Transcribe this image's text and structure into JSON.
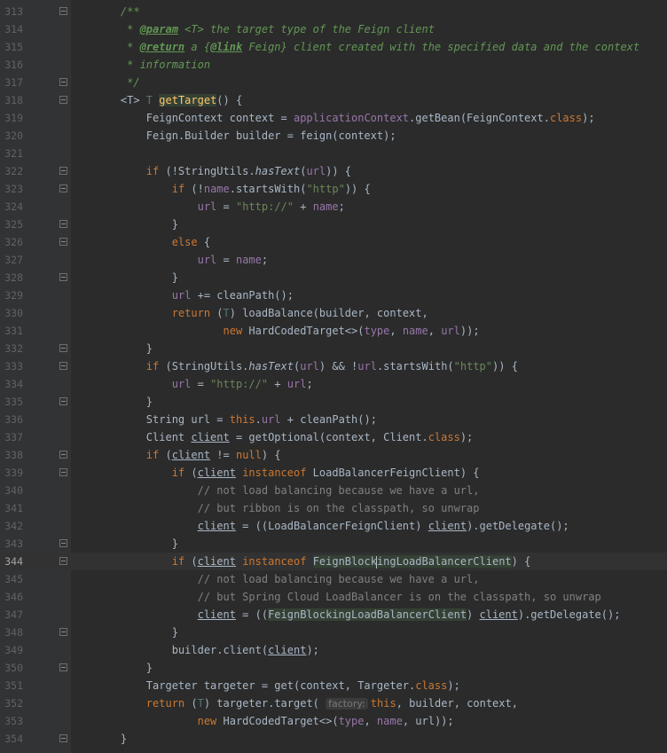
{
  "editor": {
    "current_line": "344",
    "lines": [
      {
        "n": "313",
        "fold": "open",
        "tokens": [
          [
            "    ",
            ""
          ],
          [
            "/**",
            "t-doc"
          ]
        ]
      },
      {
        "n": "314",
        "fold": "",
        "tokens": [
          [
            "     * ",
            "t-doc"
          ],
          [
            "@param",
            "t-tag"
          ],
          [
            " ",
            "t-doc"
          ],
          [
            "<T>",
            "t-doc"
          ],
          [
            " the target type of the Feign client",
            "t-doc"
          ]
        ]
      },
      {
        "n": "315",
        "fold": "",
        "tokens": [
          [
            "     * ",
            "t-doc"
          ],
          [
            "@return",
            "t-tag"
          ],
          [
            " a {",
            "t-doc"
          ],
          [
            "@link",
            "t-tag"
          ],
          [
            " Feign} client created with the specified data and the context",
            "t-doc"
          ]
        ]
      },
      {
        "n": "316",
        "fold": "",
        "tokens": [
          [
            "     * information",
            "t-doc"
          ]
        ]
      },
      {
        "n": "317",
        "fold": "close",
        "tokens": [
          [
            "     */",
            "t-doc"
          ]
        ]
      },
      {
        "n": "318",
        "fold": "open",
        "tokens": [
          [
            "    <T> ",
            ""
          ],
          [
            "T",
            "t-typ"
          ],
          [
            " ",
            ""
          ],
          [
            "getTarget",
            "t-fn t-hl"
          ],
          [
            "() {",
            ""
          ]
        ]
      },
      {
        "n": "319",
        "fold": "",
        "tokens": [
          [
            "        FeignContext context = ",
            ""
          ],
          [
            "applicationContext",
            "t-fld"
          ],
          [
            ".getBean(FeignContext.",
            ""
          ],
          [
            "class",
            "t-kw"
          ],
          [
            ");",
            ""
          ]
        ]
      },
      {
        "n": "320",
        "fold": "",
        "tokens": [
          [
            "        Feign.Builder builder = feign(context);",
            ""
          ]
        ]
      },
      {
        "n": "321",
        "fold": "",
        "tokens": []
      },
      {
        "n": "322",
        "fold": "open",
        "tokens": [
          [
            "        ",
            ""
          ],
          [
            "if",
            "t-kw"
          ],
          [
            " (!StringUtils.",
            ""
          ],
          [
            "hasText",
            "t-it"
          ],
          [
            "(",
            ""
          ],
          [
            "url",
            "t-fld"
          ],
          [
            ")) {",
            ""
          ]
        ]
      },
      {
        "n": "323",
        "fold": "open",
        "tokens": [
          [
            "            ",
            ""
          ],
          [
            "if",
            "t-kw"
          ],
          [
            " (!",
            ""
          ],
          [
            "name",
            "t-fld"
          ],
          [
            ".startsWith(",
            ""
          ],
          [
            "\"http\"",
            "t-str"
          ],
          [
            ")) {",
            ""
          ]
        ]
      },
      {
        "n": "324",
        "fold": "",
        "tokens": [
          [
            "                ",
            ""
          ],
          [
            "url",
            "t-fld"
          ],
          [
            " = ",
            ""
          ],
          [
            "\"http://\"",
            "t-str"
          ],
          [
            " + ",
            ""
          ],
          [
            "name",
            "t-fld"
          ],
          [
            ";",
            ""
          ]
        ]
      },
      {
        "n": "325",
        "fold": "close",
        "tokens": [
          [
            "            }",
            ""
          ]
        ]
      },
      {
        "n": "326",
        "fold": "open",
        "tokens": [
          [
            "            ",
            ""
          ],
          [
            "else",
            "t-kw"
          ],
          [
            " {",
            ""
          ]
        ]
      },
      {
        "n": "327",
        "fold": "",
        "tokens": [
          [
            "                ",
            ""
          ],
          [
            "url",
            "t-fld"
          ],
          [
            " = ",
            ""
          ],
          [
            "name",
            "t-fld"
          ],
          [
            ";",
            ""
          ]
        ]
      },
      {
        "n": "328",
        "fold": "close",
        "tokens": [
          [
            "            }",
            ""
          ]
        ]
      },
      {
        "n": "329",
        "fold": "",
        "tokens": [
          [
            "            ",
            ""
          ],
          [
            "url",
            "t-fld"
          ],
          [
            " += cleanPath();",
            ""
          ]
        ]
      },
      {
        "n": "330",
        "fold": "",
        "tokens": [
          [
            "            ",
            ""
          ],
          [
            "return",
            "t-kw"
          ],
          [
            " (",
            ""
          ],
          [
            "T",
            "t-typ"
          ],
          [
            ") loadBalance(builder, context,",
            ""
          ]
        ]
      },
      {
        "n": "331",
        "fold": "",
        "tokens": [
          [
            "                    ",
            ""
          ],
          [
            "new",
            "t-kw"
          ],
          [
            " HardCodedTarget<>(",
            ""
          ],
          [
            "type",
            "t-fld"
          ],
          [
            ", ",
            ""
          ],
          [
            "name",
            "t-fld"
          ],
          [
            ", ",
            ""
          ],
          [
            "url",
            "t-fld"
          ],
          [
            "));",
            ""
          ]
        ]
      },
      {
        "n": "332",
        "fold": "close",
        "tokens": [
          [
            "        }",
            ""
          ]
        ]
      },
      {
        "n": "333",
        "fold": "open",
        "tokens": [
          [
            "        ",
            ""
          ],
          [
            "if",
            "t-kw"
          ],
          [
            " (StringUtils.",
            ""
          ],
          [
            "hasText",
            "t-it"
          ],
          [
            "(",
            ""
          ],
          [
            "url",
            "t-fld"
          ],
          [
            ") && !",
            ""
          ],
          [
            "url",
            "t-fld"
          ],
          [
            ".startsWith(",
            ""
          ],
          [
            "\"http\"",
            "t-str"
          ],
          [
            ")) {",
            ""
          ]
        ]
      },
      {
        "n": "334",
        "fold": "",
        "tokens": [
          [
            "            ",
            ""
          ],
          [
            "url",
            "t-fld"
          ],
          [
            " = ",
            ""
          ],
          [
            "\"http://\"",
            "t-str"
          ],
          [
            " + ",
            ""
          ],
          [
            "url",
            "t-fld"
          ],
          [
            ";",
            ""
          ]
        ]
      },
      {
        "n": "335",
        "fold": "close",
        "tokens": [
          [
            "        }",
            ""
          ]
        ]
      },
      {
        "n": "336",
        "fold": "",
        "tokens": [
          [
            "        String url = ",
            ""
          ],
          [
            "this",
            "t-kw"
          ],
          [
            ".",
            ""
          ],
          [
            "url",
            "t-fld"
          ],
          [
            " + cleanPath();",
            ""
          ]
        ]
      },
      {
        "n": "337",
        "fold": "",
        "tokens": [
          [
            "        Client ",
            ""
          ],
          [
            "client",
            "t-ul"
          ],
          [
            " = getOptional(context, Client.",
            ""
          ],
          [
            "class",
            "t-kw"
          ],
          [
            ");",
            ""
          ]
        ]
      },
      {
        "n": "338",
        "fold": "open",
        "tokens": [
          [
            "        ",
            ""
          ],
          [
            "if",
            "t-kw"
          ],
          [
            " (",
            ""
          ],
          [
            "client",
            "t-ul"
          ],
          [
            " != ",
            ""
          ],
          [
            "null",
            "t-kw"
          ],
          [
            ") {",
            ""
          ]
        ]
      },
      {
        "n": "339",
        "fold": "open",
        "tokens": [
          [
            "            ",
            ""
          ],
          [
            "if",
            "t-kw"
          ],
          [
            " (",
            ""
          ],
          [
            "client",
            "t-ul"
          ],
          [
            " ",
            ""
          ],
          [
            "instanceof",
            "t-kw"
          ],
          [
            " LoadBalancerFeignClient) {",
            ""
          ]
        ]
      },
      {
        "n": "340",
        "fold": "",
        "tokens": [
          [
            "                // not load balancing because we have a url,",
            "t-com"
          ]
        ]
      },
      {
        "n": "341",
        "fold": "",
        "tokens": [
          [
            "                // but ribbon is on the classpath, so unwrap",
            "t-com"
          ]
        ]
      },
      {
        "n": "342",
        "fold": "",
        "tokens": [
          [
            "                ",
            ""
          ],
          [
            "client",
            "t-ul"
          ],
          [
            " = ((LoadBalancerFeignClient) ",
            ""
          ],
          [
            "client",
            "t-ul"
          ],
          [
            ").getDelegate();",
            ""
          ]
        ]
      },
      {
        "n": "343",
        "fold": "close",
        "tokens": [
          [
            "            }",
            ""
          ]
        ]
      },
      {
        "n": "344",
        "fold": "open",
        "tokens": [
          [
            "            ",
            ""
          ],
          [
            "if",
            "t-kw"
          ],
          [
            " (",
            ""
          ],
          [
            "client",
            "t-ul"
          ],
          [
            " ",
            ""
          ],
          [
            "instanceof",
            "t-kw"
          ],
          [
            " ",
            ""
          ],
          [
            "FeignBlockingLoadBalancerClient",
            "t-ident"
          ],
          [
            ") {",
            ""
          ]
        ],
        "caret_after": "FeignBlock"
      },
      {
        "n": "345",
        "fold": "",
        "tokens": [
          [
            "                // not load balancing because we have a url,",
            "t-com"
          ]
        ]
      },
      {
        "n": "346",
        "fold": "",
        "tokens": [
          [
            "                // but Spring Cloud LoadBalancer is on the classpath, so unwrap",
            "t-com"
          ]
        ]
      },
      {
        "n": "347",
        "fold": "",
        "tokens": [
          [
            "                ",
            ""
          ],
          [
            "client",
            "t-ul"
          ],
          [
            " = ((",
            ""
          ],
          [
            "FeignBlockingLoadBalancerClient",
            "t-ident"
          ],
          [
            ") ",
            ""
          ],
          [
            "client",
            "t-ul"
          ],
          [
            ").getDelegate();",
            ""
          ]
        ]
      },
      {
        "n": "348",
        "fold": "close",
        "tokens": [
          [
            "            }",
            ""
          ]
        ]
      },
      {
        "n": "349",
        "fold": "",
        "tokens": [
          [
            "            builder.client(",
            ""
          ],
          [
            "client",
            "t-ul"
          ],
          [
            ");",
            ""
          ]
        ]
      },
      {
        "n": "350",
        "fold": "close",
        "tokens": [
          [
            "        }",
            ""
          ]
        ]
      },
      {
        "n": "351",
        "fold": "",
        "tokens": [
          [
            "        Targeter targeter = get(context, Targeter.",
            ""
          ],
          [
            "class",
            "t-kw"
          ],
          [
            ");",
            ""
          ]
        ]
      },
      {
        "n": "352",
        "fold": "",
        "tokens": [
          [
            "        ",
            ""
          ],
          [
            "return",
            "t-kw"
          ],
          [
            " (",
            ""
          ],
          [
            "T",
            "t-typ"
          ],
          [
            ") targeter.target( ",
            ""
          ],
          [
            "factory:",
            "t-hint"
          ],
          [
            "this",
            "t-kw"
          ],
          [
            ", builder, context,",
            ""
          ]
        ]
      },
      {
        "n": "353",
        "fold": "",
        "tokens": [
          [
            "                ",
            ""
          ],
          [
            "new",
            "t-kw"
          ],
          [
            " HardCodedTarget<>(",
            ""
          ],
          [
            "type",
            "t-fld"
          ],
          [
            ", ",
            ""
          ],
          [
            "name",
            "t-fld"
          ],
          [
            ", url));",
            ""
          ]
        ]
      },
      {
        "n": "354",
        "fold": "close",
        "tokens": [
          [
            "    }",
            ""
          ]
        ]
      }
    ]
  }
}
